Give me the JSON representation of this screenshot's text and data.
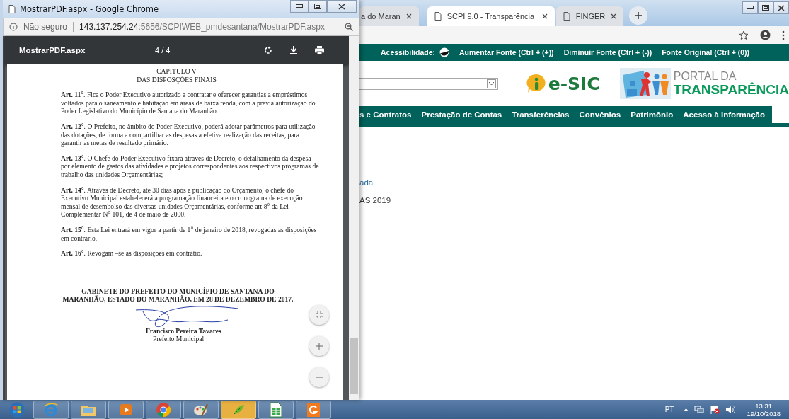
{
  "popup": {
    "title": "MostrarPDF.aspx - Google Chrome",
    "security": "Não seguro",
    "url_host": "143.137.254.24",
    "url_path": ":5656/SCPIWEB_pmdesantana/MostrarPDF.aspx",
    "pdf_toolbar": {
      "filename": "MostrarPDF.aspx",
      "page_indicator": "4 / 4"
    },
    "document": {
      "chapter": "CAPITULO V",
      "chapter_title": "DAS DISPOSÇÕES FINAIS",
      "articles": [
        {
          "text": "**Art. 11°**. Fica o Poder Executivo autorizado a contratar e oferecer garantias a empréstimos voltados para o saneamento e habitação em áreas de baixa renda, com a prévia autorização do Poder Legislativo do Município de Santana do Maranhão."
        },
        {
          "text": "**Art. 12°**. O Prefeito, no âmbito do Poder Executivo, poderá adotar parâmetros para utilização das dotações, de forma a compartilhar as despesas a efetiva realização das receitas, para garantir as metas de resultado primário."
        },
        {
          "text": "**Art. 13°**. O Chefe do Poder Executivo fixará atraves de Decreto, o detalhamento da despesa por elemento de gastos das atividades e projetos correspondentes aos respectivos programas de trabalho das unidades Orçamentárias;"
        },
        {
          "text": "**Art. 14°**. Através de Decreto, até 30 dias após a publicação do Orçamento, o chefe do Executivo Municipal estabelecerá a programação financeira e o cronograma de execução mensal de desembolso das diversas unidades Orçamentárias, conforme art 8° da Lei Complementar N° 101, de 4 de maio de 2000."
        },
        {
          "text": "**Art. 15°**. Esta Lei entrará em vigor a partir de 1° de janeiro de 2018, revogadas as disposições em contrário."
        },
        {
          "text": "**Art. 16°**. Revogam –se as disposições em contrátio."
        }
      ],
      "closing": "GABINETE DO PREFEITO DO MUNICÍPIO DE SANTANA DO MARANHÃO, ESTADO DO MARANHÃO, EM 28 DE DEZEMBRO DE 2017.",
      "signer": "Francisco Pereira Tavares",
      "signer_role": "Prefeito Municipal"
    }
  },
  "browser": {
    "tabs": [
      {
        "title": "a do Maran",
        "selected": false
      },
      {
        "title": "SCPI 9.0 - Transparência",
        "selected": true
      },
      {
        "title": "FINGER",
        "selected": false
      }
    ],
    "accessibility": {
      "label": "Acessibilidade:",
      "links": [
        "Aumentar Fonte (Ctrl + (+))",
        "Diminuir Fonte (Ctrl + (-))",
        "Fonte Original (Ctrl + (0))"
      ]
    },
    "esic_logo": "e-SIC",
    "portal_line1": "PORTAL DA",
    "portal_line2": "TRANSPARÊNCIA",
    "nav": [
      "s e Contratos",
      "Prestação de Contas",
      "Transferências",
      "Convênios",
      "Patrimônio",
      "Acesso à Informação"
    ],
    "content_lines": [
      "ada",
      "AS 2019"
    ]
  },
  "taskbar": {
    "language": "PT",
    "time": "13:31",
    "date": "19/10/2018"
  }
}
